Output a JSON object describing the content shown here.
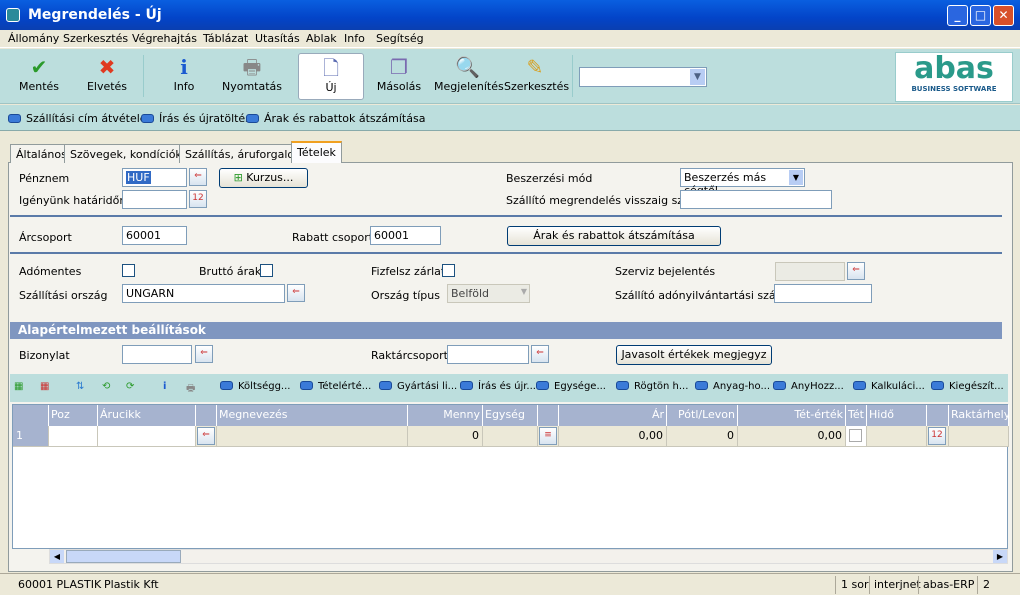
{
  "window": {
    "title": "Megrendelés - Új",
    "minimize": "_",
    "maximize": "□",
    "close": "✕"
  },
  "menu": [
    "Állomány",
    "Szerkesztés",
    "Végrehajtás",
    "Táblázat",
    "Utasítás",
    "Ablak",
    "Info",
    "Segítség"
  ],
  "toolbar": {
    "save": "Mentés",
    "discard": "Elvetés",
    "info": "Info",
    "print": "Nyomtatás",
    "new": "Új",
    "copy": "Másolás",
    "view": "Megjelenítés",
    "edit": "Szerkesztés",
    "combo_value": "",
    "logo": "abas",
    "logo_sub": "BUSINESS SOFTWARE"
  },
  "actions": [
    "Szállítási cím átvétele",
    "Írás és újratöltés",
    "Árak és rabattok átszámítása"
  ],
  "tabs": [
    "Általános",
    "Szövegek, kondíciók",
    "Szállítás, áruforgalom",
    "Tételek"
  ],
  "form": {
    "currency_label": "Pénznem",
    "currency": "HUF",
    "rate_button": "Kurzus...",
    "deadline_label": "Igényünk határidőre",
    "deadline": "",
    "procurement_label": "Beszerzési mód",
    "procurement": "Beszerzés más cégtől",
    "supplier_order_label": "Szállító megrendelés visszaig szám",
    "supplier_order": "",
    "price_group_label": "Árcsoport",
    "price_group": "60001",
    "discount_group_label": "Rabatt csoport",
    "discount_group": "60001",
    "recalc_button": "Árak és rabattok átszámítása",
    "tax_exempt_label": "Adómentes",
    "gross_label": "Bruttó árak",
    "payment_lock_label": "Fizfelsz zárlat",
    "service_label": "Szerviz bejelentés",
    "service": "",
    "country_label": "Szállítási ország",
    "country": "UNGARN",
    "country_type_label": "Ország típus",
    "country_type": "Belföld",
    "supplier_tax_label": "Szállító adónyilvántartási száma",
    "supplier_tax": "",
    "defaults_title": "Alapértelmezett beállítások",
    "document_label": "Bizonylat",
    "document": "",
    "warehouse_group_label": "Raktárcsoport",
    "warehouse_group": "",
    "suggest_button": "Javasolt értékek megjegyz"
  },
  "grid_tools": [
    "Költségg...",
    "Tételérté...",
    "Gyártási li...",
    "Írás és újr...",
    "Egysége...",
    "Rögtön h...",
    "Anyag-ho...",
    "AnyHozz...",
    "Kalkuláci...",
    "Kiegészít..."
  ],
  "grid": {
    "headers": [
      "",
      "Poz",
      "Árucikk",
      "",
      "Megnevezés",
      "Menny",
      "Egység",
      "",
      "Ár",
      "Pótl/Levon",
      "Tét-érték",
      "Tét",
      "Hidő",
      "",
      "Raktárhely"
    ],
    "rows": [
      [
        "1",
        "",
        "",
        "",
        "",
        "0",
        "",
        "",
        "0,00",
        "0",
        "0,00",
        "",
        "",
        "",
        ""
      ]
    ]
  },
  "status": {
    "customer": "60001 PLASTIK",
    "name": "Plastik Kft",
    "rows": "1 sor",
    "server": "interjnet",
    "app": "abas-ERP",
    "num": "2"
  }
}
